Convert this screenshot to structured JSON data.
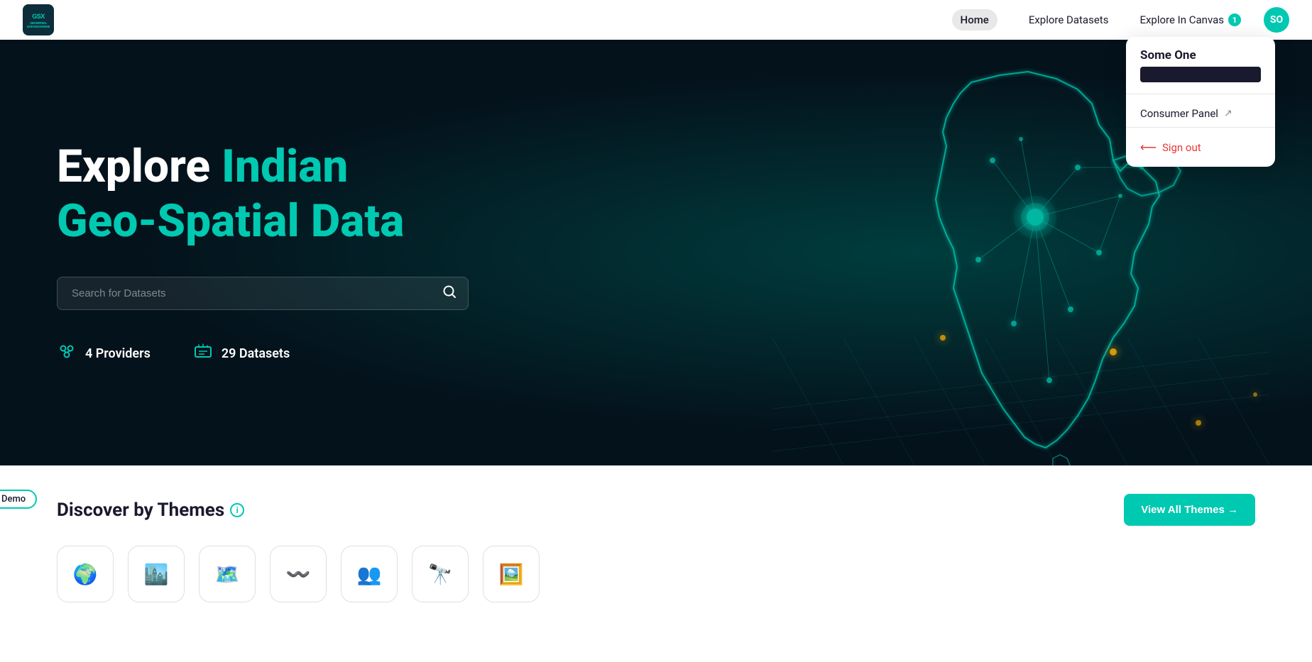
{
  "app": {
    "logo_text": "GSX",
    "logo_subtext": "GEOSPATIAL\nDATA EXCHANGE"
  },
  "navbar": {
    "home_label": "Home",
    "explore_datasets_label": "Explore Datasets",
    "explore_canvas_label": "Explore In Canvas",
    "canvas_badge": "1",
    "avatar_initials": "SO"
  },
  "dropdown": {
    "user_name": "Some One",
    "consumer_panel_label": "Consumer Panel",
    "sign_out_label": "Sign out"
  },
  "hero": {
    "title_white": "Explore",
    "title_teal_1": "Indian",
    "title_teal_2": "Geo-Spatial Data",
    "search_placeholder": "Search for Datasets",
    "stat1_value": "4 Providers",
    "stat2_value": "29 Datasets"
  },
  "themes": {
    "title": "Discover by Themes",
    "view_all_label": "View All Themes →",
    "demo_badge": "Demo"
  }
}
